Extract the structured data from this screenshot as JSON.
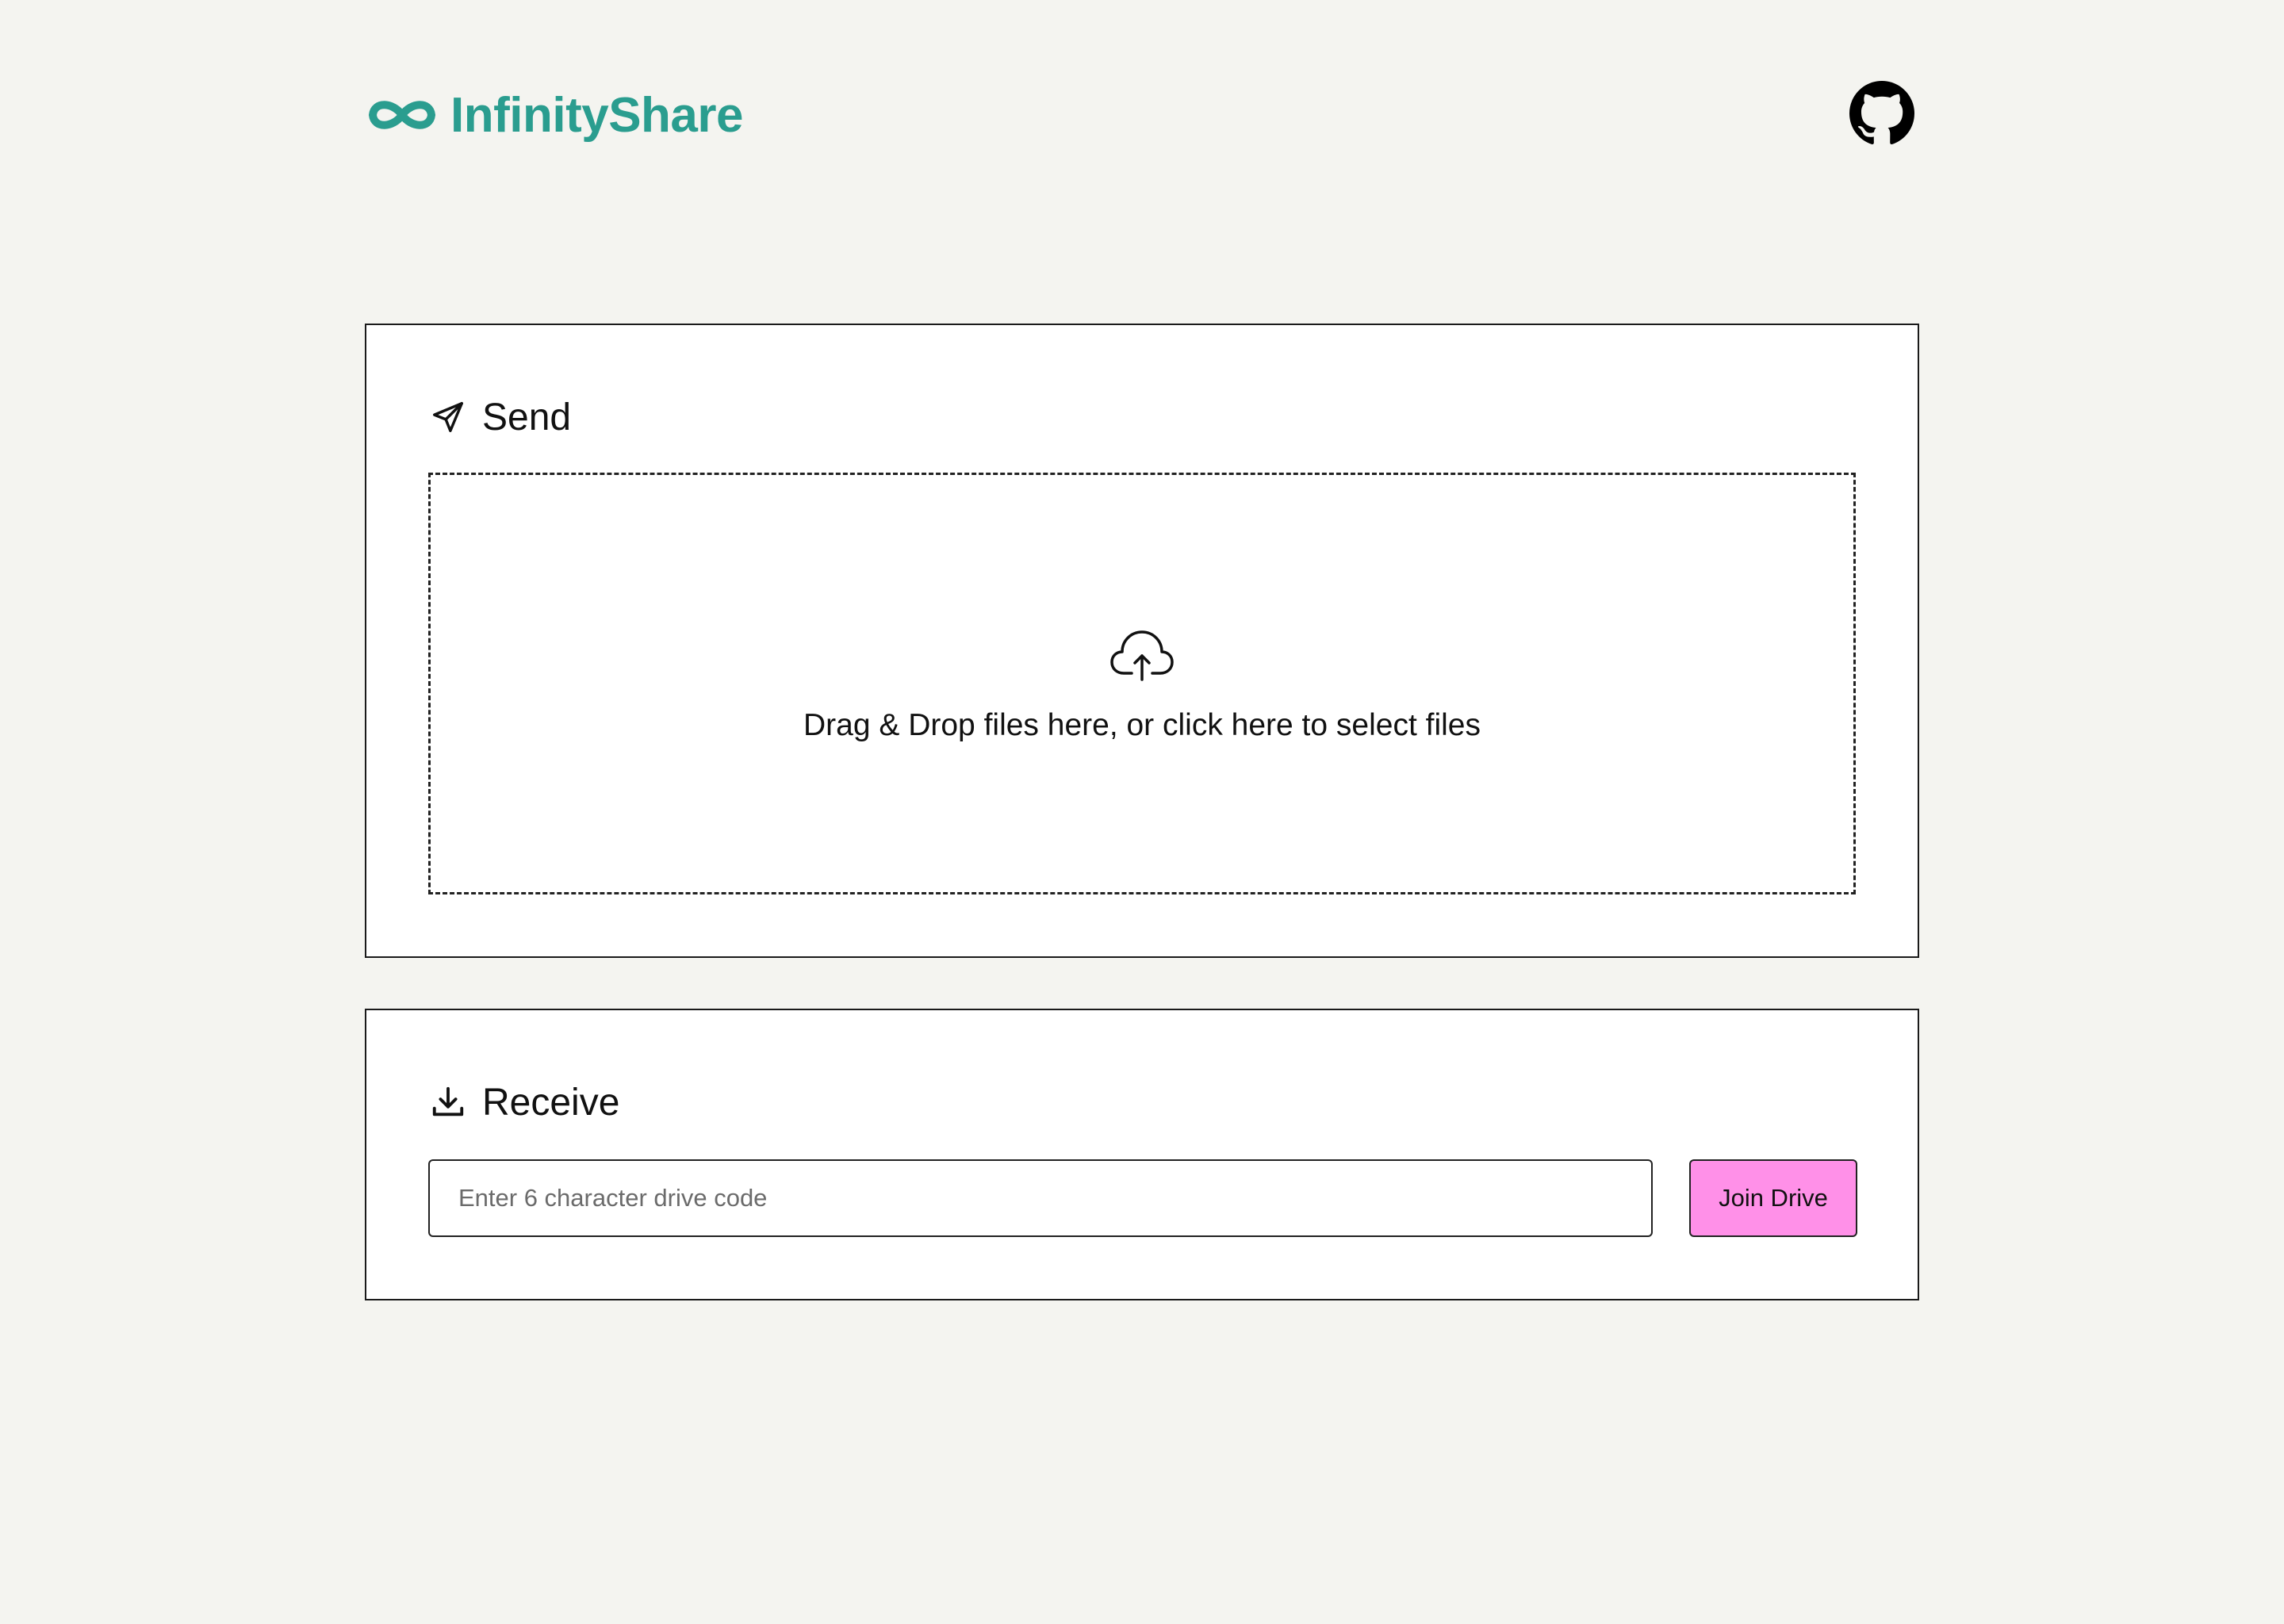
{
  "header": {
    "brand": "InfinityShare",
    "logo_icon": "infinity-icon",
    "github_icon": "github-icon"
  },
  "send": {
    "title": "Send",
    "icon": "send-icon",
    "dropzone": {
      "icon": "cloud-upload-icon",
      "text": "Drag & Drop files here, or click here to select files"
    }
  },
  "receive": {
    "title": "Receive",
    "icon": "download-icon",
    "code_input": {
      "value": "",
      "placeholder": "Enter 6 character drive code"
    },
    "join_label": "Join Drive"
  },
  "colors": {
    "background": "#f4f4f0",
    "brand": "#2a9d8f",
    "button": "#ff90e8",
    "card": "#ffffff",
    "border": "#1a1a1a"
  }
}
